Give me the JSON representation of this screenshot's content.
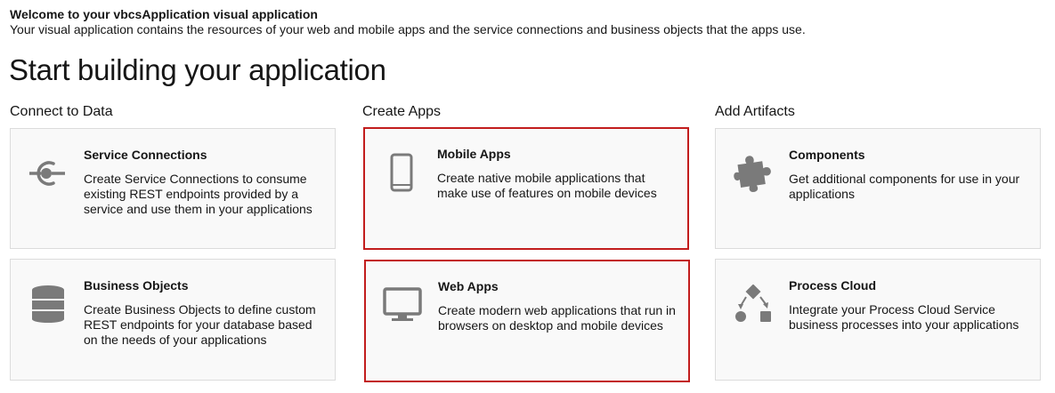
{
  "welcome": {
    "title": "Welcome to your vbcsApplication visual application",
    "description": "Your visual application contains the resources of your web and mobile apps and the service connections and business objects that the apps use."
  },
  "heading": "Start building your application",
  "sections": {
    "connect": "Connect to Data",
    "create": "Create Apps",
    "artifacts": "Add Artifacts"
  },
  "cards": {
    "service_connections": {
      "title": "Service Connections",
      "description": "Create Service Connections to consume existing REST endpoints provided by a service and use them in your applications",
      "icon": "service-connection-icon"
    },
    "business_objects": {
      "title": "Business Objects",
      "description": "Create Business Objects to define custom REST endpoints for your database based on the needs of your applications",
      "icon": "database-icon"
    },
    "mobile_apps": {
      "title": "Mobile Apps",
      "description": "Create native mobile applications that make use of features on mobile devices",
      "icon": "mobile-phone-icon"
    },
    "web_apps": {
      "title": "Web Apps",
      "description": "Create modern web applications that run in browsers on desktop and mobile devices",
      "icon": "desktop-monitor-icon"
    },
    "components": {
      "title": "Components",
      "description": "Get additional components for use in your applications",
      "icon": "puzzle-piece-icon"
    },
    "process_cloud": {
      "title": "Process Cloud",
      "description": "Integrate your Process Cloud Service business processes into your applications",
      "icon": "process-shapes-icon"
    }
  },
  "colors": {
    "highlight_border": "#c21d1d",
    "icon_gray": "#7a7a7a",
    "card_background": "#f9f9f9"
  }
}
